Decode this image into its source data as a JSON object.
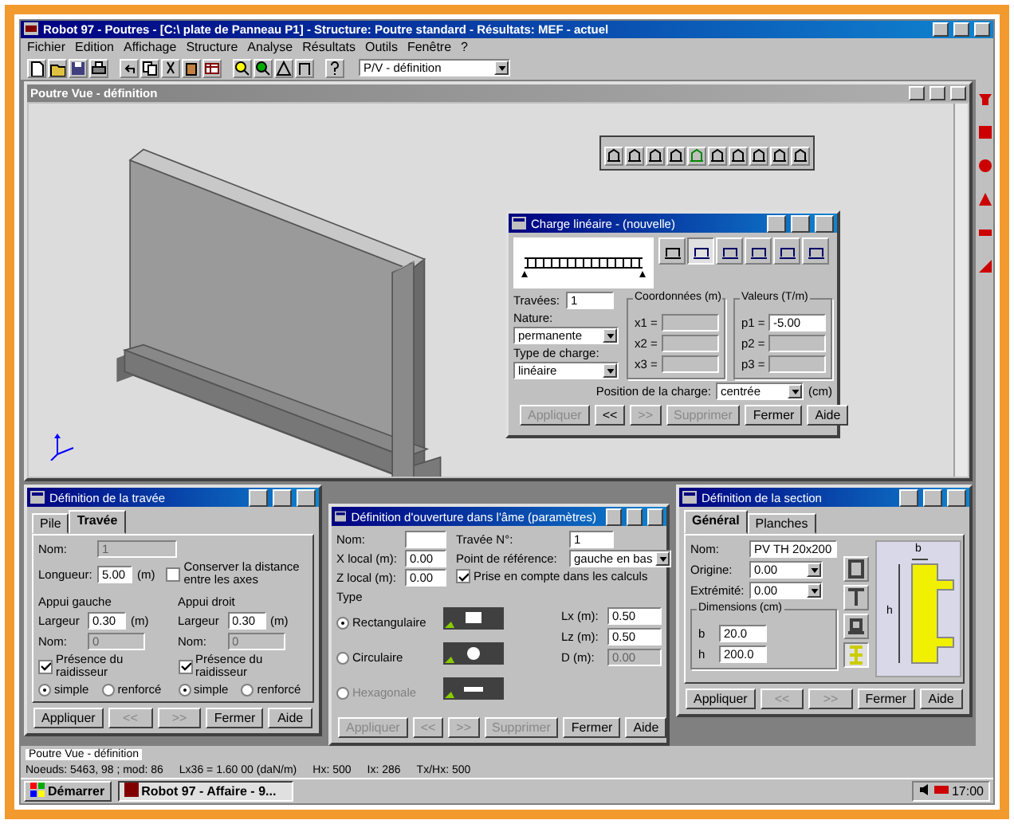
{
  "window": {
    "title": "Robot 97 - Poutres - [C:\\ plate de Panneau P1] - Structure: Poutre standard - Résultats: MEF - actuel",
    "menu": [
      "Fichier",
      "Edition",
      "Affichage",
      "Structure",
      "Analyse",
      "Résultats",
      "Outils",
      "Fenêtre",
      "?"
    ]
  },
  "toolbar": {
    "dropdown": "P/V - définition"
  },
  "view": {
    "title": "Poutre Vue - définition"
  },
  "load_dialog": {
    "title": "Charge linéaire - (nouvelle)",
    "load_types": [
      {
        "selected": false
      },
      {
        "selected": true
      },
      {
        "selected": false
      },
      {
        "selected": false
      },
      {
        "selected": false
      },
      {
        "selected": false
      }
    ],
    "span_label": "Travées:",
    "span_value": "1",
    "nature_label": "Nature:",
    "nature_value": "permanente",
    "type_label": "Type de charge:",
    "type_value": "linéaire",
    "coords_title": "Coordonnées (m)",
    "coords": [
      {
        "label": "x1 =",
        "disabled": true
      },
      {
        "label": "x2 =",
        "disabled": true
      },
      {
        "label": "x3 =",
        "disabled": true
      }
    ],
    "values_title": "Valeurs (T/m)",
    "values": [
      {
        "label": "p1 =",
        "value": "-5.00",
        "disabled": false
      },
      {
        "label": "p2 =",
        "disabled": true
      },
      {
        "label": "p3 =",
        "disabled": true
      }
    ],
    "position_label": "Position de la charge:",
    "position_value": "centrée",
    "position_unit": "(cm)",
    "buttons": [
      {
        "label": "Appliquer",
        "disabled": true
      },
      {
        "label": "<<",
        "disabled": false
      },
      {
        "label": ">>",
        "disabled": true
      },
      {
        "label": "Supprimer",
        "disabled": true
      },
      {
        "label": "Fermer",
        "disabled": false
      },
      {
        "label": "Aide",
        "disabled": false
      }
    ]
  },
  "span_dialog": {
    "title": "Définition de la travée",
    "tabs": [
      {
        "label": "Pile",
        "selected": false
      },
      {
        "label": "Travée",
        "selected": true
      }
    ],
    "name_label": "Nom:",
    "name_value": "1",
    "length_label": "Longueur:",
    "length_value": "5.00",
    "length_unit": "(m)",
    "keep_axes": {
      "label": "Conserver la distance entre les axes",
      "checked": false
    },
    "supports": [
      {
        "title": "Appui gauche",
        "width_label": "Largeur",
        "width_value": "0.30",
        "unit": "(m)",
        "name_label": "Nom:",
        "name_value": "0",
        "stiffener": {
          "label": "Présence du raidisseur",
          "checked": true
        },
        "options": [
          {
            "label": "simple",
            "selected": true
          },
          {
            "label": "renforcé",
            "selected": false
          }
        ]
      },
      {
        "title": "Appui droit",
        "width_label": "Largeur",
        "width_value": "0.30",
        "unit": "(m)",
        "name_label": "Nom:",
        "name_value": "0",
        "stiffener": {
          "label": "Présence du raidisseur",
          "checked": true
        },
        "options": [
          {
            "label": "simple",
            "selected": true
          },
          {
            "label": "renforcé",
            "selected": false
          }
        ]
      }
    ],
    "buttons": [
      {
        "label": "Appliquer",
        "disabled": false
      },
      {
        "label": "<<",
        "disabled": true
      },
      {
        "label": ">>",
        "disabled": true
      },
      {
        "label": "Fermer",
        "disabled": false
      },
      {
        "label": "Aide",
        "disabled": false
      }
    ]
  },
  "opening_dialog": {
    "title": "Définition d'ouverture dans l'âme (paramètres)",
    "fields": [
      {
        "label": "Nom:"
      },
      {
        "label": "X local (m):",
        "value": "0.00"
      },
      {
        "label": "Z local (m):",
        "value": "0.00"
      }
    ],
    "span_label": "Travée N°:",
    "span_value": "1",
    "ref_label": "Point de référence:",
    "ref_value": "gauche en bas",
    "in_calc": {
      "label": "Prise en compte dans les calculs",
      "checked": true
    },
    "type_title": "Type",
    "types": [
      {
        "label": "Rectangulaire",
        "selected": true,
        "disabled": false,
        "kind": "rect"
      },
      {
        "label": "Circulaire",
        "selected": false,
        "disabled": false,
        "kind": "circle"
      },
      {
        "label": "Hexagonale",
        "selected": false,
        "disabled": true,
        "kind": "hex"
      }
    ],
    "dims": [
      {
        "label": "Lx (m):",
        "value": "0.50",
        "disabled": false
      },
      {
        "label": "Lz (m):",
        "value": "0.50",
        "disabled": false
      },
      {
        "label": "D (m):",
        "value": "0.00",
        "disabled": true
      }
    ],
    "buttons": [
      {
        "label": "Appliquer",
        "disabled": true
      },
      {
        "label": "<<",
        "disabled": true
      },
      {
        "label": ">>",
        "disabled": true
      },
      {
        "label": "Supprimer",
        "disabled": true
      },
      {
        "label": "Fermer",
        "disabled": false
      },
      {
        "label": "Aide",
        "disabled": false
      }
    ]
  },
  "section_dialog": {
    "title": "Définition de la section",
    "tabs": [
      {
        "label": "Général",
        "selected": true
      },
      {
        "label": "Planches",
        "selected": false
      }
    ],
    "name_label": "Nom:",
    "name_value": "PV TH 20x200",
    "origin_label": "Origine:",
    "origin_value": "0.00",
    "end_label": "Extrémité:",
    "end_value": "0.00",
    "dims_title": "Dimensions (cm)",
    "dims": [
      {
        "label": "b",
        "value": "20.0"
      },
      {
        "label": "h",
        "value": "200.0"
      }
    ],
    "shapes": [
      {
        "selected": false
      },
      {
        "selected": false
      },
      {
        "selected": false
      },
      {
        "selected": true
      }
    ],
    "b_label": "b",
    "h_label": "h",
    "buttons": [
      {
        "label": "Appliquer",
        "disabled": false
      },
      {
        "label": "<<",
        "disabled": true
      },
      {
        "label": ">>",
        "disabled": true
      },
      {
        "label": "Fermer",
        "disabled": false
      },
      {
        "label": "Aide",
        "disabled": false
      }
    ]
  },
  "status_bar": {
    "view": "Poutre Vue - définition",
    "items": [
      "Noeuds: 5463, 98 ; mod: 86",
      "Lx36 = 1.60 00 (daN/m)",
      "Hx: 500",
      "Ix: 286",
      "Tx/Hx: 500"
    ]
  },
  "taskbar": {
    "start": "Démarrer",
    "task": "Robot 97 - Affaire - 9...",
    "clock": "17:00"
  }
}
